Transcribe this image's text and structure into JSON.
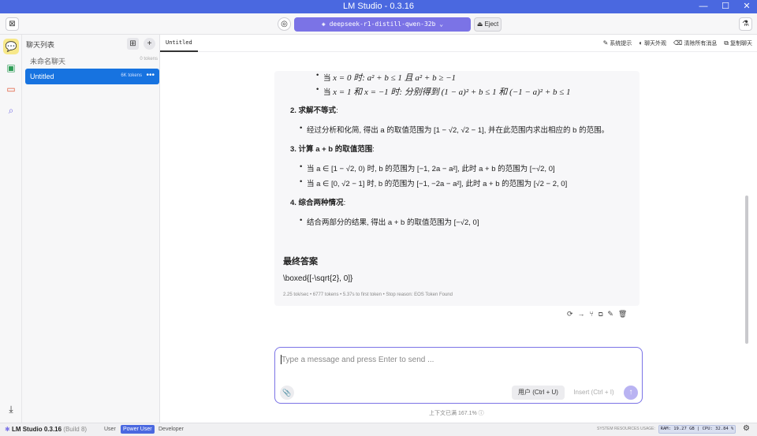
{
  "window": {
    "title": "LM Studio - 0.3.16",
    "minimize": "—",
    "maximize": "☐",
    "close": "✕"
  },
  "toolbar": {
    "model": "deepseek-r1-distill-qwen-32b",
    "eject": "Eject"
  },
  "chatlist": {
    "title": "聊天列表",
    "items": [
      {
        "name": "未命名聊天",
        "tokens": "0 tokens"
      },
      {
        "name": "Untitled",
        "tokens": "6K tokens"
      }
    ]
  },
  "tab": {
    "label": "Untitled"
  },
  "actions": {
    "system_prompt": "系统提示",
    "chat_appearance": "聊天外观",
    "clear_all": "清除所有消息",
    "copy_chat": "复制聊天"
  },
  "message": {
    "line1_prefix": "当 ",
    "line1_math": "x = 0 时: a² + b ≤ 1 且 a² + b ≥ −1",
    "line2_prefix": "当 ",
    "line2_math": "x = 1 和 x = −1 时: 分别得到 (1 − a)² + b ≤ 1 和 (−1 − a)² + b ≤ 1",
    "step2_title": "2. 求解不等式",
    "step2_colon": ":",
    "step2_line": "经过分析和化简, 得出 a 的取值范围为 [1 − √2, √2 − 1], 并在此范围内求出相应的 b 的范围。",
    "step3_title": "3. 计算 a + b 的取值范围",
    "step3_colon": ":",
    "step3_line1": "当 a ∈ [1 − √2, 0) 时, b 的范围为 [−1, 2a − a²], 此时 a + b 的范围为 [−√2, 0]",
    "step3_line2": "当 a ∈ [0, √2 − 1] 时, b 的范围为 [−1, −2a − a²], 此时 a + b 的范围为 [√2 − 2, 0]",
    "step4_title": "4. 综合两种情况",
    "step4_colon": ":",
    "step4_line": "结合两部分的结果, 得出 a + b 的取值范围为 [−√2, 0]",
    "final_title": "最终答案",
    "final_answer": "\\boxed{[-\\sqrt{2}, 0]}",
    "stats": "2.25 tok/sec • 6777 tokens • 5.37s to first token • Stop reason: EOS Token Found"
  },
  "input": {
    "placeholder": "Type a message and press Enter to send ...",
    "role_button": "用户 (Ctrl + U)",
    "insert_button": "Insert (Ctrl + I)"
  },
  "context_usage": "上下文已满 167.1% ⓘ",
  "statusbar": {
    "app": "LM Studio 0.3.16",
    "build": "(Build 8)",
    "modes": [
      "User",
      "Power User",
      "Developer"
    ],
    "resources_label": "SYSTEM RESOURCES USAGE:",
    "resources": "RAM: 19.27 GB | CPU: 32.84 %"
  }
}
